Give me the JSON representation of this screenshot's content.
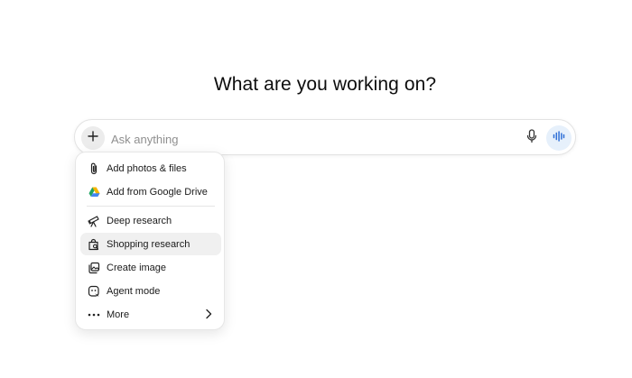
{
  "heading": "What are you working on?",
  "composer": {
    "placeholder": "Ask anything",
    "value": ""
  },
  "icons": {
    "plus": "plus-icon",
    "mic": "microphone-icon",
    "voice": "voice-mode-icon"
  },
  "colors": {
    "voice_button_bg": "#e6f0fb",
    "voice_button_fg": "#2f6fd6",
    "active_item_bg": "#f0f0f0"
  },
  "menu": {
    "items": [
      {
        "label": "Add photos & files",
        "icon": "paperclip-icon"
      },
      {
        "label": "Add from Google Drive",
        "icon": "google-drive-icon"
      },
      {
        "label": "Deep research",
        "icon": "telescope-icon"
      },
      {
        "label": "Shopping research",
        "icon": "shopping-bag-search-icon",
        "active": true
      },
      {
        "label": "Create image",
        "icon": "image-stack-icon"
      },
      {
        "label": "Agent mode",
        "icon": "agent-icon"
      },
      {
        "label": "More",
        "icon": "more-dots-icon",
        "submenu": true
      }
    ]
  }
}
